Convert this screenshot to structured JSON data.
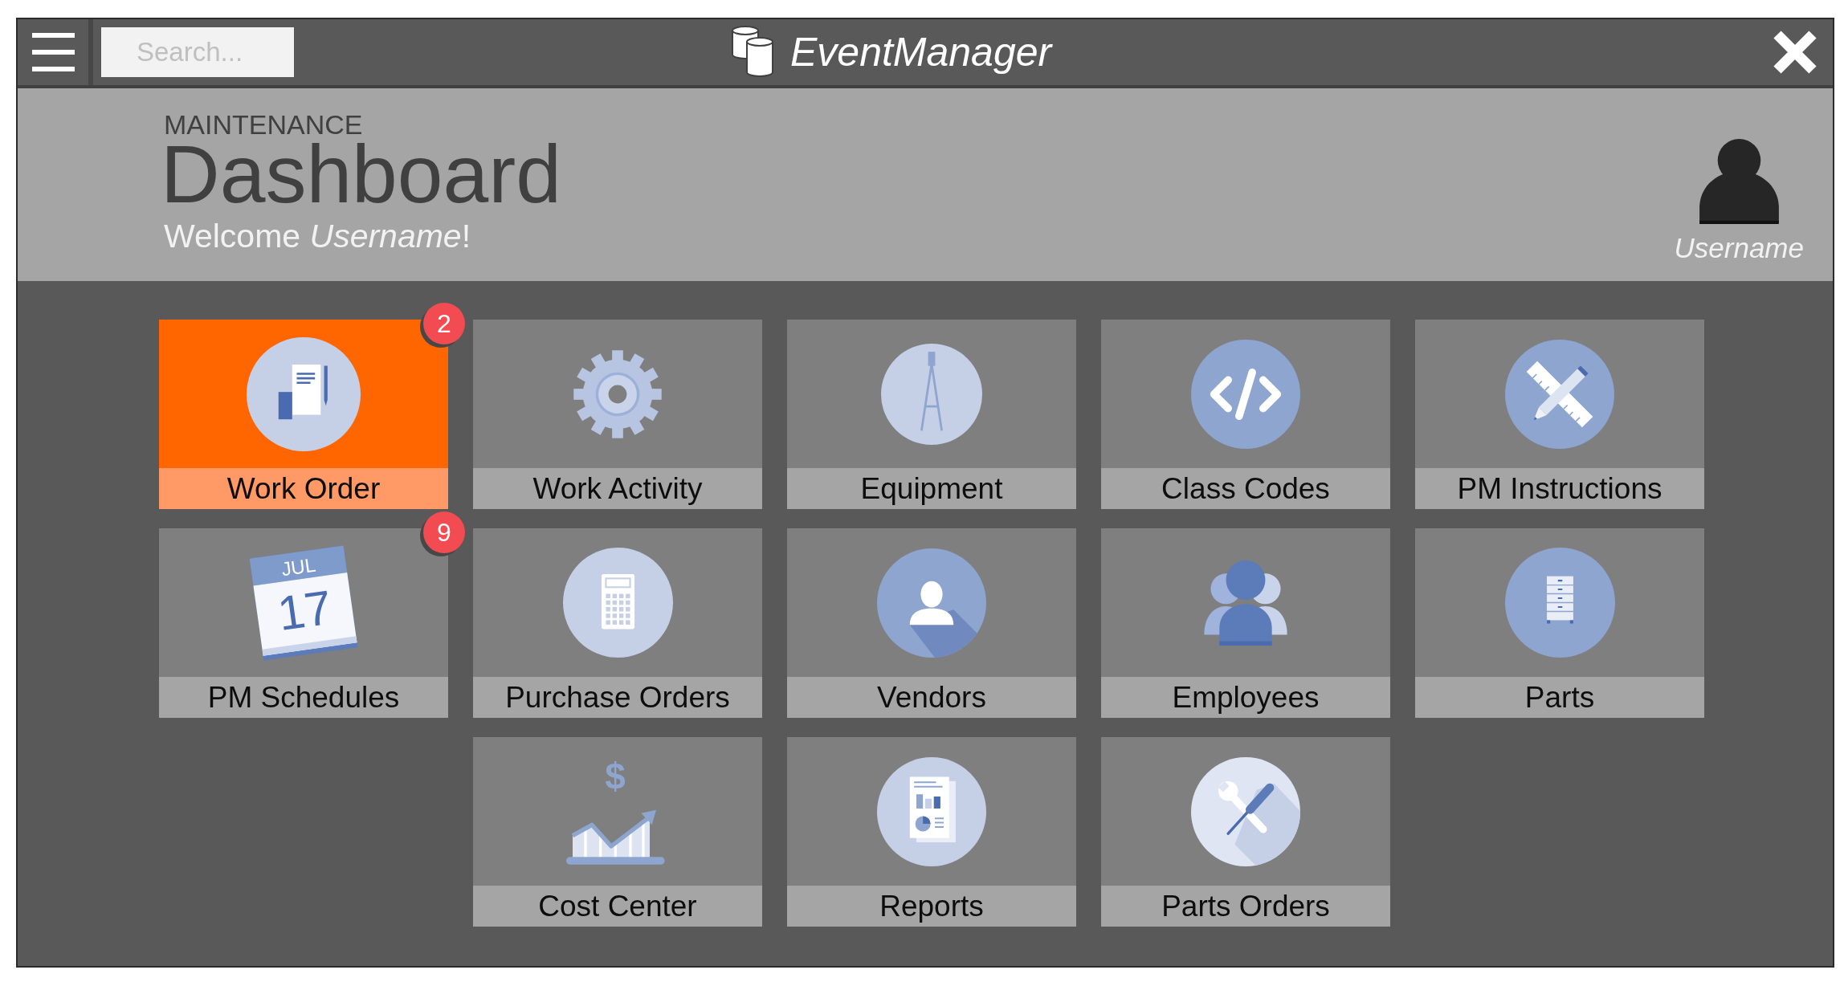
{
  "window": {
    "title": "EventManager"
  },
  "top_bar": {
    "search": {
      "placeholder": "Search..."
    }
  },
  "header": {
    "section": "MAINTENANCE",
    "title": "Dashboard",
    "welcome": "Welcome *Username*!",
    "user": {
      "name": "Username"
    }
  },
  "tile_rows": [
    {
      "tiles": [
        {
          "label": "Work Order",
          "selected": true,
          "badge": "2"
        },
        {
          "label": "Work Activity",
          "selected": false
        },
        {
          "label": "Equipment",
          "selected": false
        },
        {
          "label": "Class Codes",
          "selected": false
        },
        {
          "label": "PM Instructions",
          "selected": false
        }
      ]
    },
    {
      "tiles": [
        {
          "label": "PM Schedules",
          "selected": false,
          "badge": "9",
          "calendar": {
            "month": "JUL",
            "day": "17"
          }
        },
        {
          "label": "Purchase Orders",
          "selected": false
        },
        {
          "label": "Vendors",
          "selected": false
        },
        {
          "label": "Employees",
          "selected": false
        },
        {
          "label": "Parts",
          "selected": false
        }
      ]
    },
    {
      "tiles": [
        {
          "label": "Cost Center",
          "selected": false,
          "currency": "$"
        },
        {
          "label": "Reports",
          "selected": false
        },
        {
          "label": "Parts Orders",
          "selected": false
        }
      ]
    }
  ]
}
